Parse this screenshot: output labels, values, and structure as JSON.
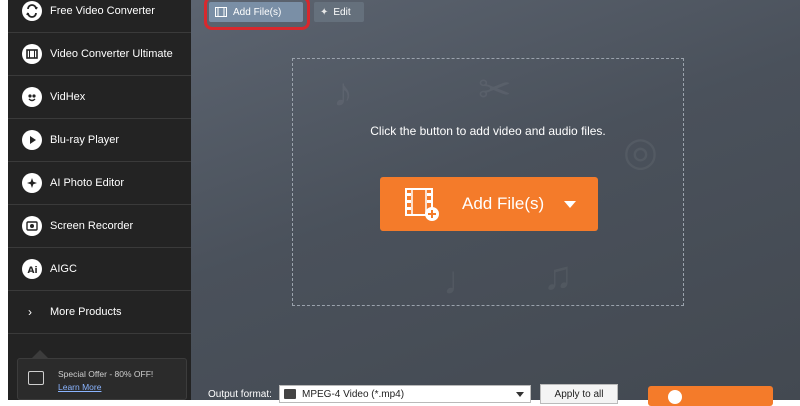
{
  "sidebar": {
    "items": [
      {
        "label": "Free Video Converter",
        "icon": "converter-icon"
      },
      {
        "label": "Video Converter Ultimate",
        "icon": "film-icon"
      },
      {
        "label": "VidHex",
        "icon": "vidhex-icon"
      },
      {
        "label": "Blu-ray Player",
        "icon": "play-icon"
      },
      {
        "label": "AI Photo Editor",
        "icon": "photo-editor-icon"
      },
      {
        "label": "Screen Recorder",
        "icon": "record-icon"
      },
      {
        "label": "AIGC",
        "icon": "aigc-icon"
      },
      {
        "label": "More Products",
        "icon": "chevron-right-icon"
      }
    ],
    "offer": {
      "text": "Special Offer - 80% OFF!",
      "link": "Learn More"
    }
  },
  "toolbar": {
    "add_files_label": "Add File(s)",
    "edit_label": "Edit"
  },
  "dropzone": {
    "prompt": "Click the button to add video and audio files.",
    "add_button_label": "Add File(s)"
  },
  "bottom": {
    "output_label": "Output format:",
    "format_value": "MPEG-4 Video (*.mp4)",
    "apply_label": "Apply to all"
  },
  "colors": {
    "accent": "#f47b2a",
    "sidebar_bg": "#232323",
    "highlight": "#d8282d"
  }
}
